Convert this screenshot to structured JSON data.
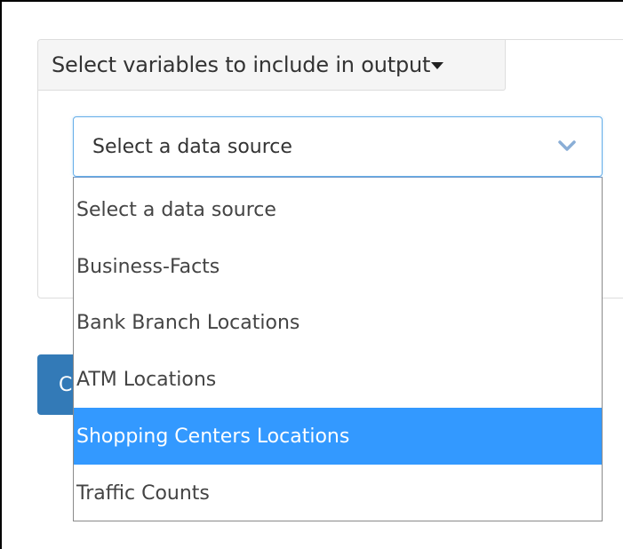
{
  "panel": {
    "heading": "Select variables to include in output"
  },
  "data_source_select": {
    "value": "Select a data source",
    "options": [
      "Select a data source",
      "Business-Facts",
      "Bank Branch Locations",
      "ATM Locations",
      "Shopping Centers Locations",
      "Traffic Counts"
    ],
    "highlighted_option": "Shopping Centers Locations"
  },
  "partially_hidden_button": {
    "label_fragment": "C"
  },
  "colors": {
    "highlight": "#3399ff",
    "button": "#337ab7",
    "focus_border": "#66afe9"
  }
}
